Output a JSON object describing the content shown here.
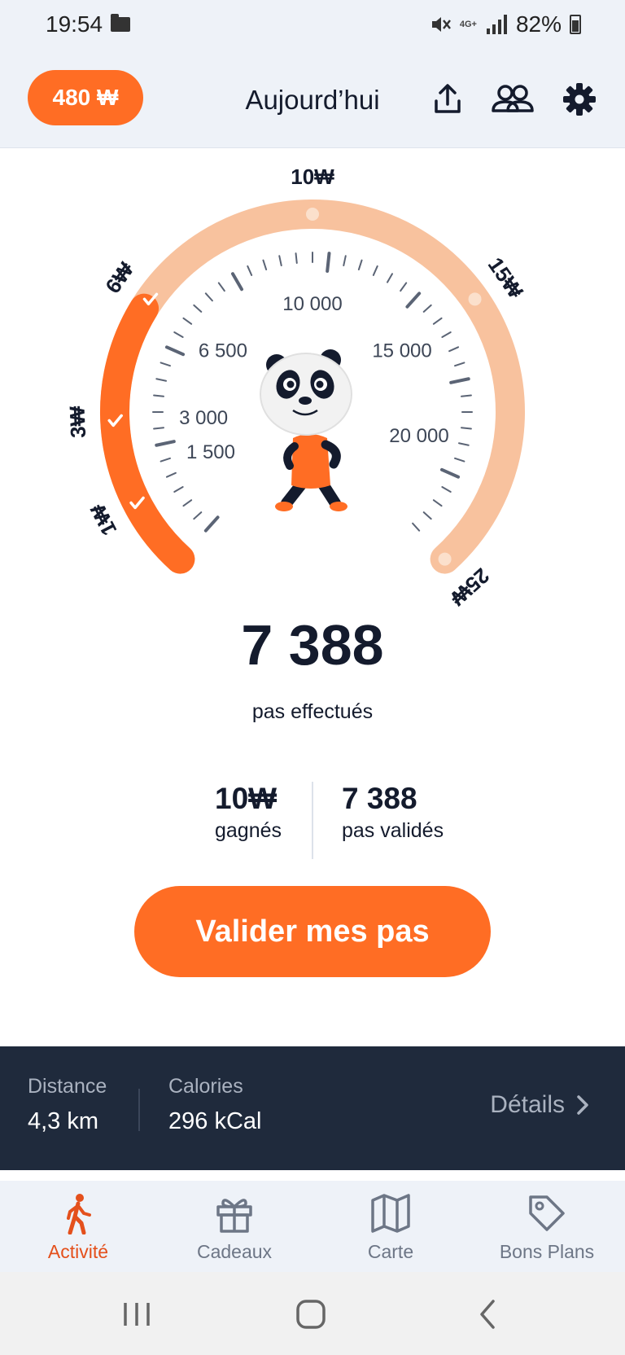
{
  "status_bar": {
    "time": "19:54",
    "network": "4G+",
    "battery": "82%"
  },
  "header": {
    "balance": "480 ₩",
    "title": "Aujourd’hui",
    "icons": [
      "share-icon",
      "friends-icon",
      "settings-icon"
    ]
  },
  "gauge": {
    "current_steps": 7388,
    "max_steps": 25000,
    "rewards": [
      {
        "label": "1₩",
        "steps": 1000,
        "reached": true
      },
      {
        "label": "3₩",
        "steps": 3000,
        "reached": true
      },
      {
        "label": "6₩",
        "steps": 6500,
        "reached": true
      },
      {
        "label": "10₩",
        "steps": 10000,
        "reached": false
      },
      {
        "label": "15₩",
        "steps": 15000,
        "reached": false
      },
      {
        "label": "25₩",
        "steps": 25000,
        "reached": false
      }
    ],
    "step_markers": [
      "1 500",
      "3 000",
      "6 500",
      "10 000",
      "15 000",
      "20 000"
    ],
    "mascot": "panda-walking"
  },
  "steps": {
    "count": "7 388",
    "label": "pas effectués"
  },
  "stats": {
    "earned_value": "10₩",
    "earned_label": "gagnés",
    "validated_value": "7 388",
    "validated_label": "pas validés"
  },
  "validate_button": "Valider mes pas",
  "summary": {
    "distance_label": "Distance",
    "distance_value": "4,3 km",
    "calories_label": "Calories",
    "calories_value": "296 kCal",
    "details_label": "Détails"
  },
  "bottom_nav": [
    {
      "label": "Activité",
      "icon": "walking-icon",
      "active": true
    },
    {
      "label": "Cadeaux",
      "icon": "gift-icon",
      "active": false
    },
    {
      "label": "Carte",
      "icon": "map-icon",
      "active": false
    },
    {
      "label": "Bons Plans",
      "icon": "tag-icon",
      "active": false
    }
  ],
  "colors": {
    "accent": "#ff6d24",
    "accent_light": "#f8c29e",
    "dark": "#141b2d",
    "summary_bg": "#1f2a3c",
    "active_nav": "#e4501c"
  }
}
